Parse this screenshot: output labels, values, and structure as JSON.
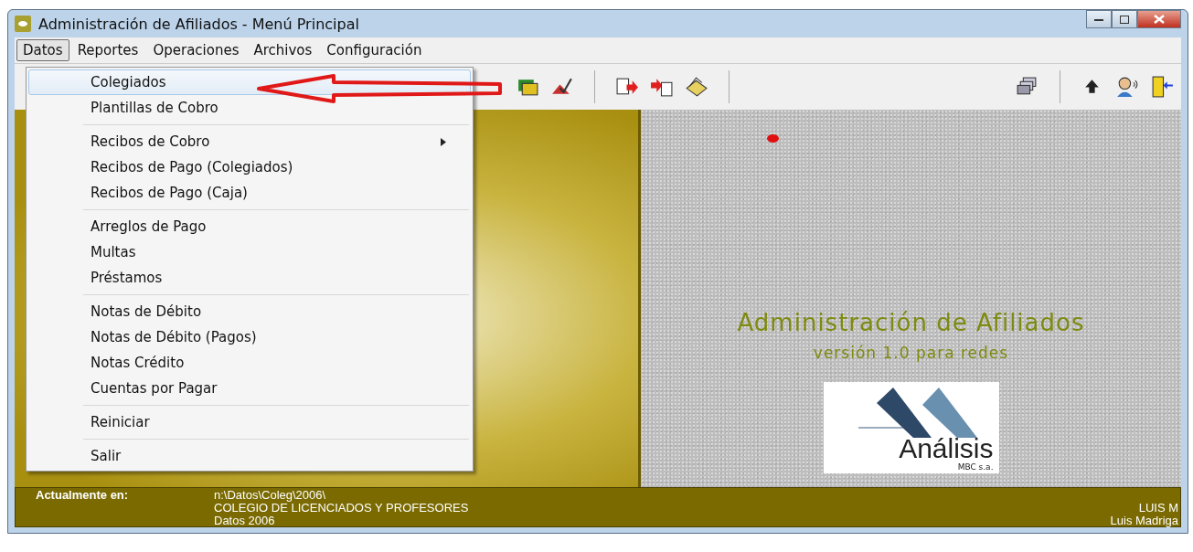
{
  "window": {
    "title": "Administración de Afiliados - Menú Principal"
  },
  "menubar": [
    {
      "label": "Datos",
      "selected": true
    },
    {
      "label": "Reportes",
      "selected": false
    },
    {
      "label": "Operaciones",
      "selected": false
    },
    {
      "label": "Archivos",
      "selected": false
    },
    {
      "label": "Configuración",
      "selected": false
    }
  ],
  "dropdown": {
    "groups": [
      [
        {
          "label": "Colegiados",
          "selected": true,
          "submenu": false
        },
        {
          "label": "Plantillas de Cobro",
          "selected": false,
          "submenu": false
        }
      ],
      [
        {
          "label": "Recibos de Cobro",
          "selected": false,
          "submenu": true
        },
        {
          "label": "Recibos de Pago (Colegiados)",
          "selected": false,
          "submenu": false
        },
        {
          "label": "Recibos de Pago (Caja)",
          "selected": false,
          "submenu": false
        }
      ],
      [
        {
          "label": "Arreglos de Pago",
          "selected": false,
          "submenu": false
        },
        {
          "label": "Multas",
          "selected": false,
          "submenu": false
        },
        {
          "label": "Préstamos",
          "selected": false,
          "submenu": false
        }
      ],
      [
        {
          "label": "Notas de Débito",
          "selected": false,
          "submenu": false
        },
        {
          "label": "Notas de Débito (Pagos)",
          "selected": false,
          "submenu": false
        },
        {
          "label": "Notas Crédito",
          "selected": false,
          "submenu": false
        },
        {
          "label": "Cuentas por Pagar",
          "selected": false,
          "submenu": false
        }
      ],
      [
        {
          "label": "Reiniciar",
          "selected": false,
          "submenu": false
        }
      ],
      [
        {
          "label": "Salir",
          "selected": false,
          "submenu": false
        }
      ]
    ]
  },
  "splash": {
    "title": "Administración de Afiliados",
    "subtitle": "versión 1.0 para redes",
    "logo_name": "Análisis",
    "logo_company": "MBC s.a."
  },
  "status_bar": {
    "label": "Actualmente en:",
    "path": "n:\\Datos\\Coleg\\2006\\",
    "organization": "COLEGIO DE LICENCIADOS Y PROFESORES",
    "dataset": "Datos 2006",
    "user_short": "LUIS M",
    "user_name": "Luis Madriga"
  }
}
